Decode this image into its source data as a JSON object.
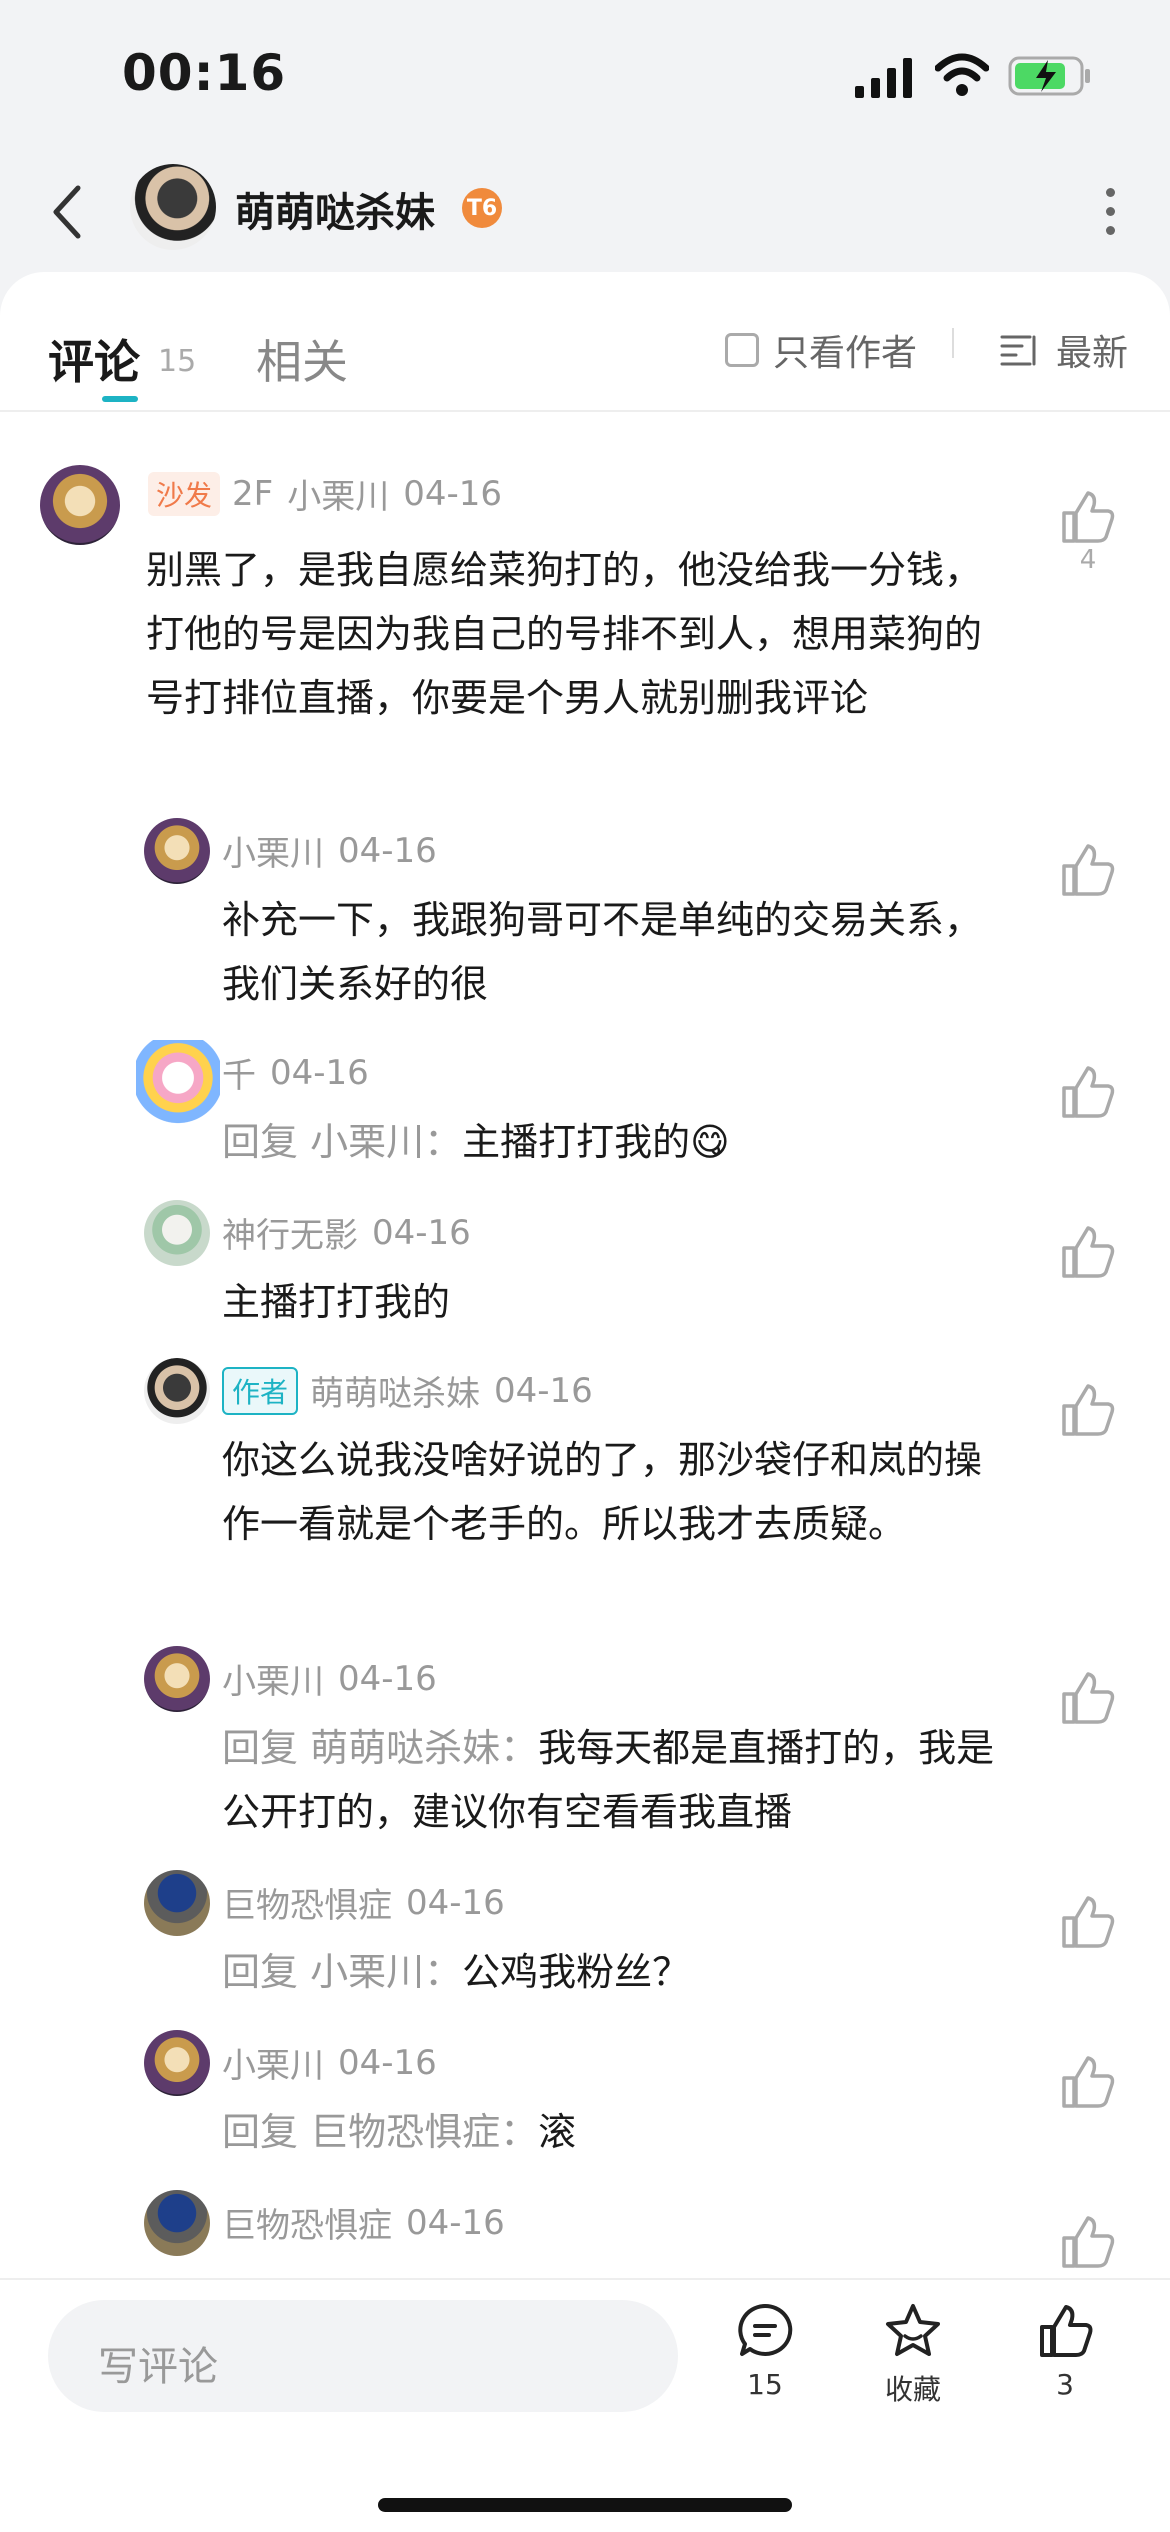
{
  "status": {
    "time": "00:16"
  },
  "nav": {
    "name": "萌萌哒杀妹",
    "level_badge": "T6"
  },
  "tabs": {
    "comments_label": "评论",
    "comments_count": "15",
    "related_label": "相关"
  },
  "filters": {
    "author_only": "只看作者",
    "sort": "最新"
  },
  "comments": [
    {
      "badge": "沙发",
      "floor": "2F",
      "name": "小栗川",
      "date": "04-16",
      "text": "别黑了，是我自愿给菜狗打的，他没给我一分钱，打他的号是因为我自己的号排不到人，想用菜狗的号打排位直播，你要是个男人就别删我评论",
      "likes": "4"
    },
    {
      "name": "小栗川",
      "date": "04-16",
      "text": "补充一下，我跟狗哥可不是单纯的交易关系，我们关系好的很"
    },
    {
      "name": "千",
      "date": "04-16",
      "reply_prefix": "回复 小栗川：",
      "text": "主播打打我的😋"
    },
    {
      "name": "神行无影",
      "date": "04-16",
      "text": "主播打打我的"
    },
    {
      "badge": "作者",
      "name": "萌萌哒杀妹",
      "date": "04-16",
      "text": "你这么说我没啥好说的了，那沙袋仔和岚的操作一看就是个老手的。所以我才去质疑。"
    },
    {
      "name": "小栗川",
      "date": "04-16",
      "reply_prefix": "回复 萌萌哒杀妹：",
      "text": "我每天都是直播打的，我是公开打的，建议你有空看看我直播"
    },
    {
      "name": "巨物恐惧症",
      "date": "04-16",
      "reply_prefix": "回复 小栗川：",
      "text": "公鸡我粉丝？"
    },
    {
      "name": "小栗川",
      "date": "04-16",
      "reply_prefix": "回复 巨物恐惧症：",
      "text": "滚"
    },
    {
      "name": "巨物恐惧症",
      "date": "04-16"
    }
  ],
  "bottom": {
    "placeholder": "写评论",
    "comment_count": "15",
    "favorite_label": "收藏",
    "like_count": "3"
  },
  "colors": {
    "accent": "#1db3c4",
    "sofa": "#f07a4a",
    "level": "#f08a3c"
  }
}
